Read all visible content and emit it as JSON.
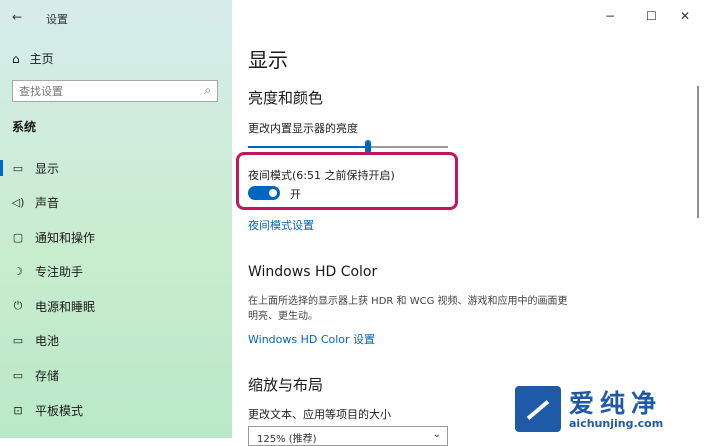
{
  "window": {
    "back_icon": "←",
    "title": "设置",
    "minimize_icon": "−",
    "maximize_icon": "☐",
    "close_icon": "✕"
  },
  "sidebar": {
    "home": {
      "icon": "⌂",
      "label": "主页"
    },
    "search": {
      "placeholder": "查找设置",
      "icon": "⌕"
    },
    "section": "系统",
    "items": [
      {
        "icon": "▭",
        "label": "显示",
        "active": true
      },
      {
        "icon": "◁)",
        "label": "声音"
      },
      {
        "icon": "▢",
        "label": "通知和操作"
      },
      {
        "icon": "☽",
        "label": "专注助手"
      },
      {
        "icon": "⏻",
        "label": "电源和睡眠"
      },
      {
        "icon": "▭",
        "label": "电池"
      },
      {
        "icon": "▭",
        "label": "存储"
      },
      {
        "icon": "⊡",
        "label": "平板模式"
      }
    ]
  },
  "main": {
    "title": "显示",
    "brightness": {
      "heading": "亮度和颜色",
      "label": "更改内置显示器的亮度",
      "value_fraction": 0.6
    },
    "night_light": {
      "label": "夜间模式(6:51 之前保持开启)",
      "state": "开",
      "settings_link": "夜间模式设置"
    },
    "hd_color": {
      "heading": "Windows HD Color",
      "description": "在上面所选择的显示器上获 HDR 和 WCG 视频、游戏和应用中的画面更明亮、更生动。",
      "link": "Windows HD Color 设置"
    },
    "scale": {
      "heading": "缩放与布局",
      "label": "更改文本、应用等项目的大小",
      "value": "125% (推荐)",
      "chevron": "⌄"
    }
  },
  "watermark": {
    "title": "爱纯净",
    "url": "aichunjing.com"
  },
  "colors": {
    "accent": "#0067c0",
    "highlight": "#c2185b",
    "brand": "#1e5aa8"
  }
}
